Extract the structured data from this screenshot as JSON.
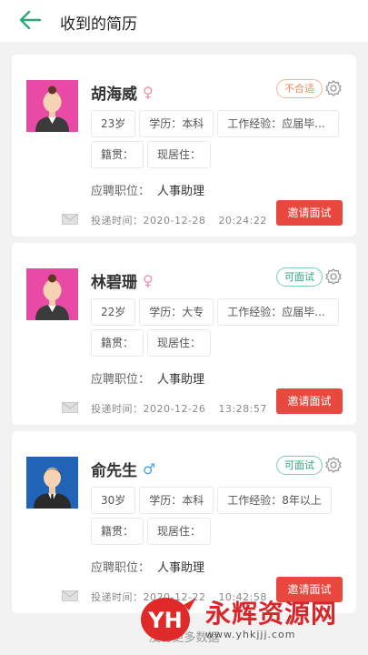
{
  "header": {
    "title": "收到的简历"
  },
  "cards": [
    {
      "name": "胡海威",
      "gender_symbol": "♀",
      "status": "不合适",
      "age": "23岁",
      "education": "学历：本科",
      "experience": "工作经验：应届毕...",
      "origin": "籍贯：",
      "residence": "现居住：",
      "job_label": "应聘职位：",
      "job": "人事助理",
      "time_label": "投递时间：",
      "date": "2020-12-28",
      "clock": "20:24:22",
      "invite": "邀请面试"
    },
    {
      "name": "林碧珊",
      "gender_symbol": "♀",
      "status": "可面试",
      "age": "22岁",
      "education": "学历：大专",
      "experience": "工作经验：应届毕...",
      "origin": "籍贯：",
      "residence": "现居住：",
      "job_label": "应聘职位：",
      "job": "人事助理",
      "time_label": "投递时间：",
      "date": "2020-12-26",
      "clock": "13:28:57",
      "invite": "邀请面试"
    },
    {
      "name": "俞先生",
      "gender_symbol": "♂",
      "status": "可面试",
      "age": "30岁",
      "education": "学历：本科",
      "experience": "工作经验：8年以上",
      "origin": "籍贯：",
      "residence": "现居住：",
      "job_label": "应聘职位：",
      "job": "人事助理",
      "time_label": "投递时间：",
      "date": "2020-12-22",
      "clock": "10:42:58",
      "invite": "邀请面试"
    }
  ],
  "footer": {
    "text": "没有更多数据"
  },
  "watermark": {
    "logo": "YH",
    "name": "永辉资源网",
    "url": "www.yhkjjj.com"
  },
  "colors": {
    "accent": "#2aa877",
    "invite": "#e8483e",
    "female": "#f58ea8",
    "male": "#4aa3e8"
  }
}
